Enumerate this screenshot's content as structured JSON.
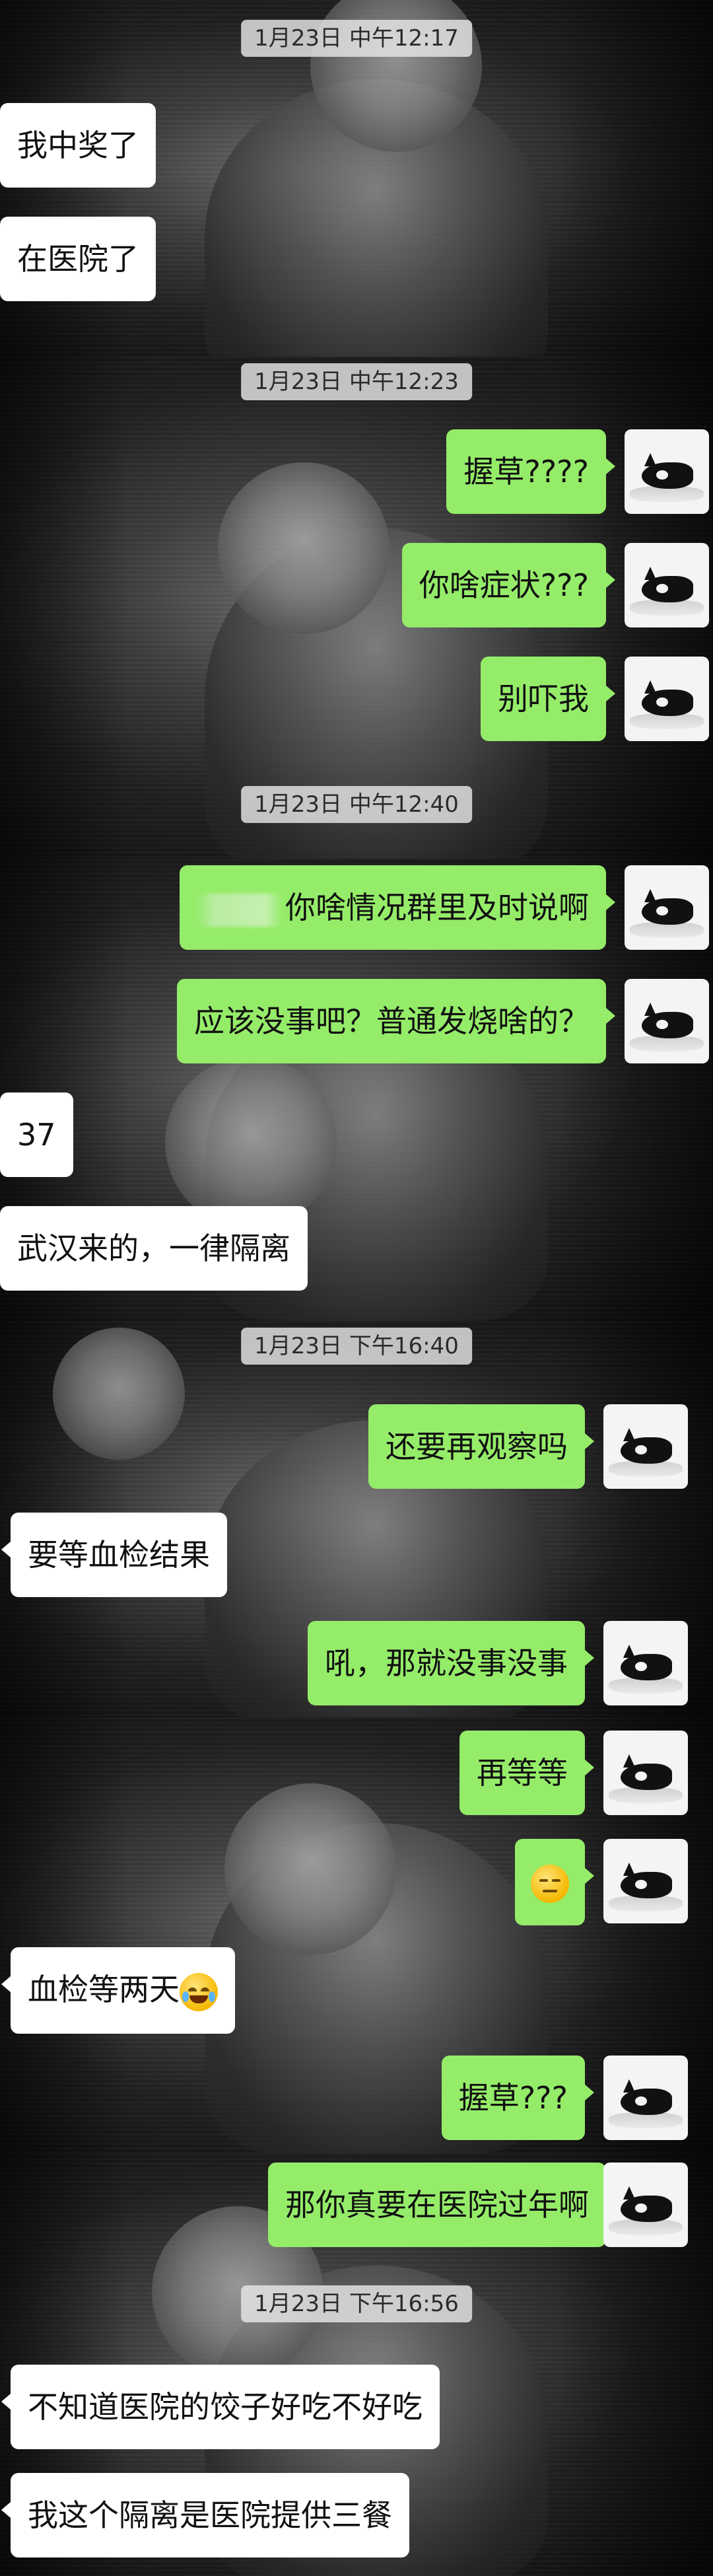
{
  "panels": [
    {
      "timestamp": "1月23日 中午12:17",
      "messages": [
        {
          "side": "in",
          "text": "我中奖了"
        },
        {
          "side": "in",
          "text": "在医院了"
        }
      ]
    },
    {
      "timestamp": "1月23日 中午12:23",
      "messages": [
        {
          "side": "out",
          "text": "握草????"
        },
        {
          "side": "out",
          "text": "你啥症状???"
        },
        {
          "side": "out",
          "text": "别吓我"
        }
      ]
    },
    {
      "timestamp": "1月23日 中午12:40",
      "messages": [
        {
          "side": "out",
          "text": "你啥情况群里及时说啊"
        },
        {
          "side": "out",
          "text": "应该没事吧？普通发烧啥的？"
        },
        {
          "side": "in",
          "text": "37"
        },
        {
          "side": "in",
          "text": "武汉来的，一律隔离"
        }
      ]
    },
    {
      "timestamp": "1月23日 下午16:40",
      "messages": [
        {
          "side": "out",
          "text": "还要再观察吗"
        },
        {
          "side": "in",
          "text": "要等血检结果"
        },
        {
          "side": "out",
          "text": "吼，那就没事没事"
        }
      ]
    },
    {
      "timestamp": "",
      "messages": [
        {
          "side": "out",
          "text": "再等等"
        },
        {
          "side": "out",
          "text": "",
          "emoji": "expressionless-emoji"
        },
        {
          "side": "in",
          "text": "血检等两天",
          "emoji": "tears-of-joy-emoji"
        },
        {
          "side": "out",
          "text": "握草???"
        }
      ]
    },
    {
      "timestamp": "1月23日 下午16:56",
      "messages": [
        {
          "side": "out",
          "text": "那你真要在医院过年啊"
        },
        {
          "side": "in",
          "text": "不知道医院的饺子好吃不好吃"
        },
        {
          "side": "in",
          "text": "我这个隔离是医院提供三餐"
        }
      ]
    }
  ],
  "colors": {
    "outgoing_bubble": "#95ec69",
    "incoming_bubble": "#ffffff",
    "timestamp_bg": "#e6e6e6"
  },
  "icons": {
    "avatar": "cat-avatar-icon",
    "redaction": "blurred-name"
  }
}
